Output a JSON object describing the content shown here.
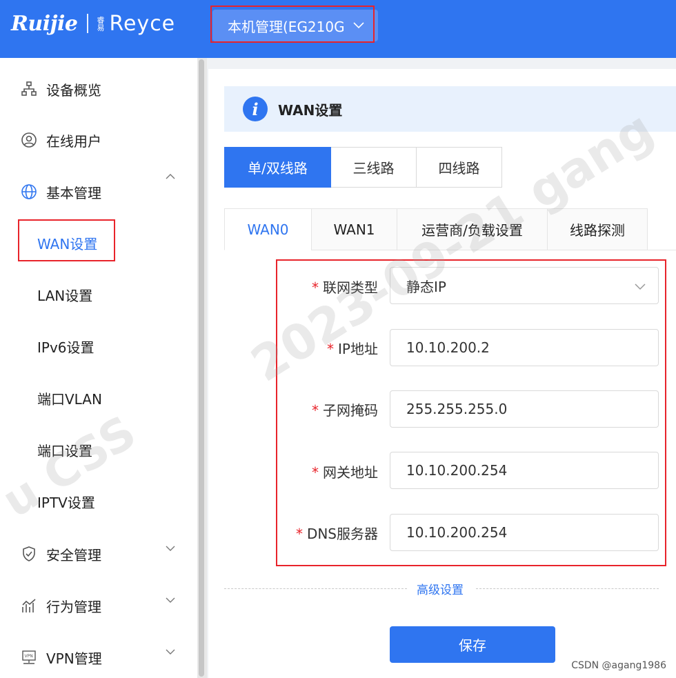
{
  "header": {
    "logo_primary": "Ruijie",
    "logo_secondary": "Reyce",
    "logo_secondary_prefix": "睿易",
    "device_select": "本机管理(EG210G",
    "color": "#2f75f0"
  },
  "sidebar": {
    "items": [
      {
        "label": "设备概览",
        "icon": "topology-icon"
      },
      {
        "label": "在线用户",
        "icon": "user-circle-icon"
      },
      {
        "label": "基本管理",
        "icon": "globe-icon",
        "expanded": true
      },
      {
        "label": "安全管理",
        "icon": "shield-check-icon"
      },
      {
        "label": "行为管理",
        "icon": "chart-icon"
      },
      {
        "label": "VPN管理",
        "icon": "vpn-icon"
      }
    ],
    "sub_items": [
      "WAN设置",
      "LAN设置",
      "IPv6设置",
      "端口VLAN",
      "端口设置",
      "IPTV设置"
    ],
    "active_sub_item": "WAN设置"
  },
  "main": {
    "title": "WAN设置",
    "line_modes": [
      "单/双线路",
      "三线路",
      "四线路"
    ],
    "active_line_mode": "单/双线路",
    "tabs": [
      "WAN0",
      "WAN1",
      "运营商/负载设置",
      "线路探测"
    ],
    "active_tab": "WAN0",
    "form": {
      "connection_type_label": "联网类型",
      "connection_type_value": "静态IP",
      "ip_label": "IP地址",
      "ip_value": "10.10.200.2",
      "mask_label": "子网掩码",
      "mask_value": "255.255.255.0",
      "gateway_label": "网关地址",
      "gateway_value": "10.10.200.254",
      "dns_label": "DNS服务器",
      "dns_value": "10.10.200.254",
      "required_mark": "*"
    },
    "advanced_link": "高级设置",
    "save_label": "保存"
  },
  "watermarks": {
    "diagonal_main": "2023-09-21 gang",
    "diagonal_left": "u CSS"
  },
  "footer": {
    "credit": "CSDN @agang1986"
  }
}
